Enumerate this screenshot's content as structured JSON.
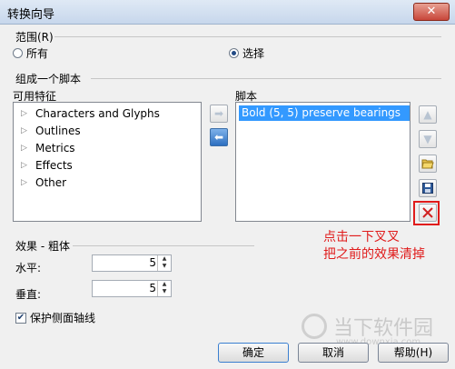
{
  "window": {
    "title": "转换向导",
    "close_glyph": "✕"
  },
  "scope": {
    "group_label": "范围(R)",
    "options": [
      {
        "label": "所有",
        "selected": false
      },
      {
        "label": "选择",
        "selected": true
      }
    ]
  },
  "compose": {
    "group_label": "组成一个脚本",
    "available_label": "可用特征",
    "script_label": "脚本",
    "features": [
      "Characters and Glyphs",
      "Outlines",
      "Metrics",
      "Effects",
      "Other"
    ],
    "script_items": [
      "Bold (5, 5) preserve bearings"
    ],
    "icons": {
      "add": "right-arrow-icon",
      "remove": "left-arrow-icon",
      "up": "move-up-icon",
      "down": "move-down-icon",
      "open": "open-folder-icon",
      "save": "save-icon",
      "delete": "delete-icon"
    }
  },
  "annotation": {
    "line1": "点击一下叉叉",
    "line2": "把之前的效果清掉",
    "color": "#e01b1b"
  },
  "effect": {
    "group_label": "效果 - 粗体",
    "horizontal_label": "水平:",
    "horizontal_value": "5",
    "vertical_label": "垂直:",
    "vertical_value": "5",
    "keep_sidebearing_label": "保护侧面轴线",
    "keep_sidebearing_checked": true
  },
  "buttons": {
    "ok": "确定",
    "cancel": "取消",
    "help": "帮助(H)"
  },
  "watermark": {
    "text": "当下软件园",
    "url": "www.downxia.com"
  }
}
